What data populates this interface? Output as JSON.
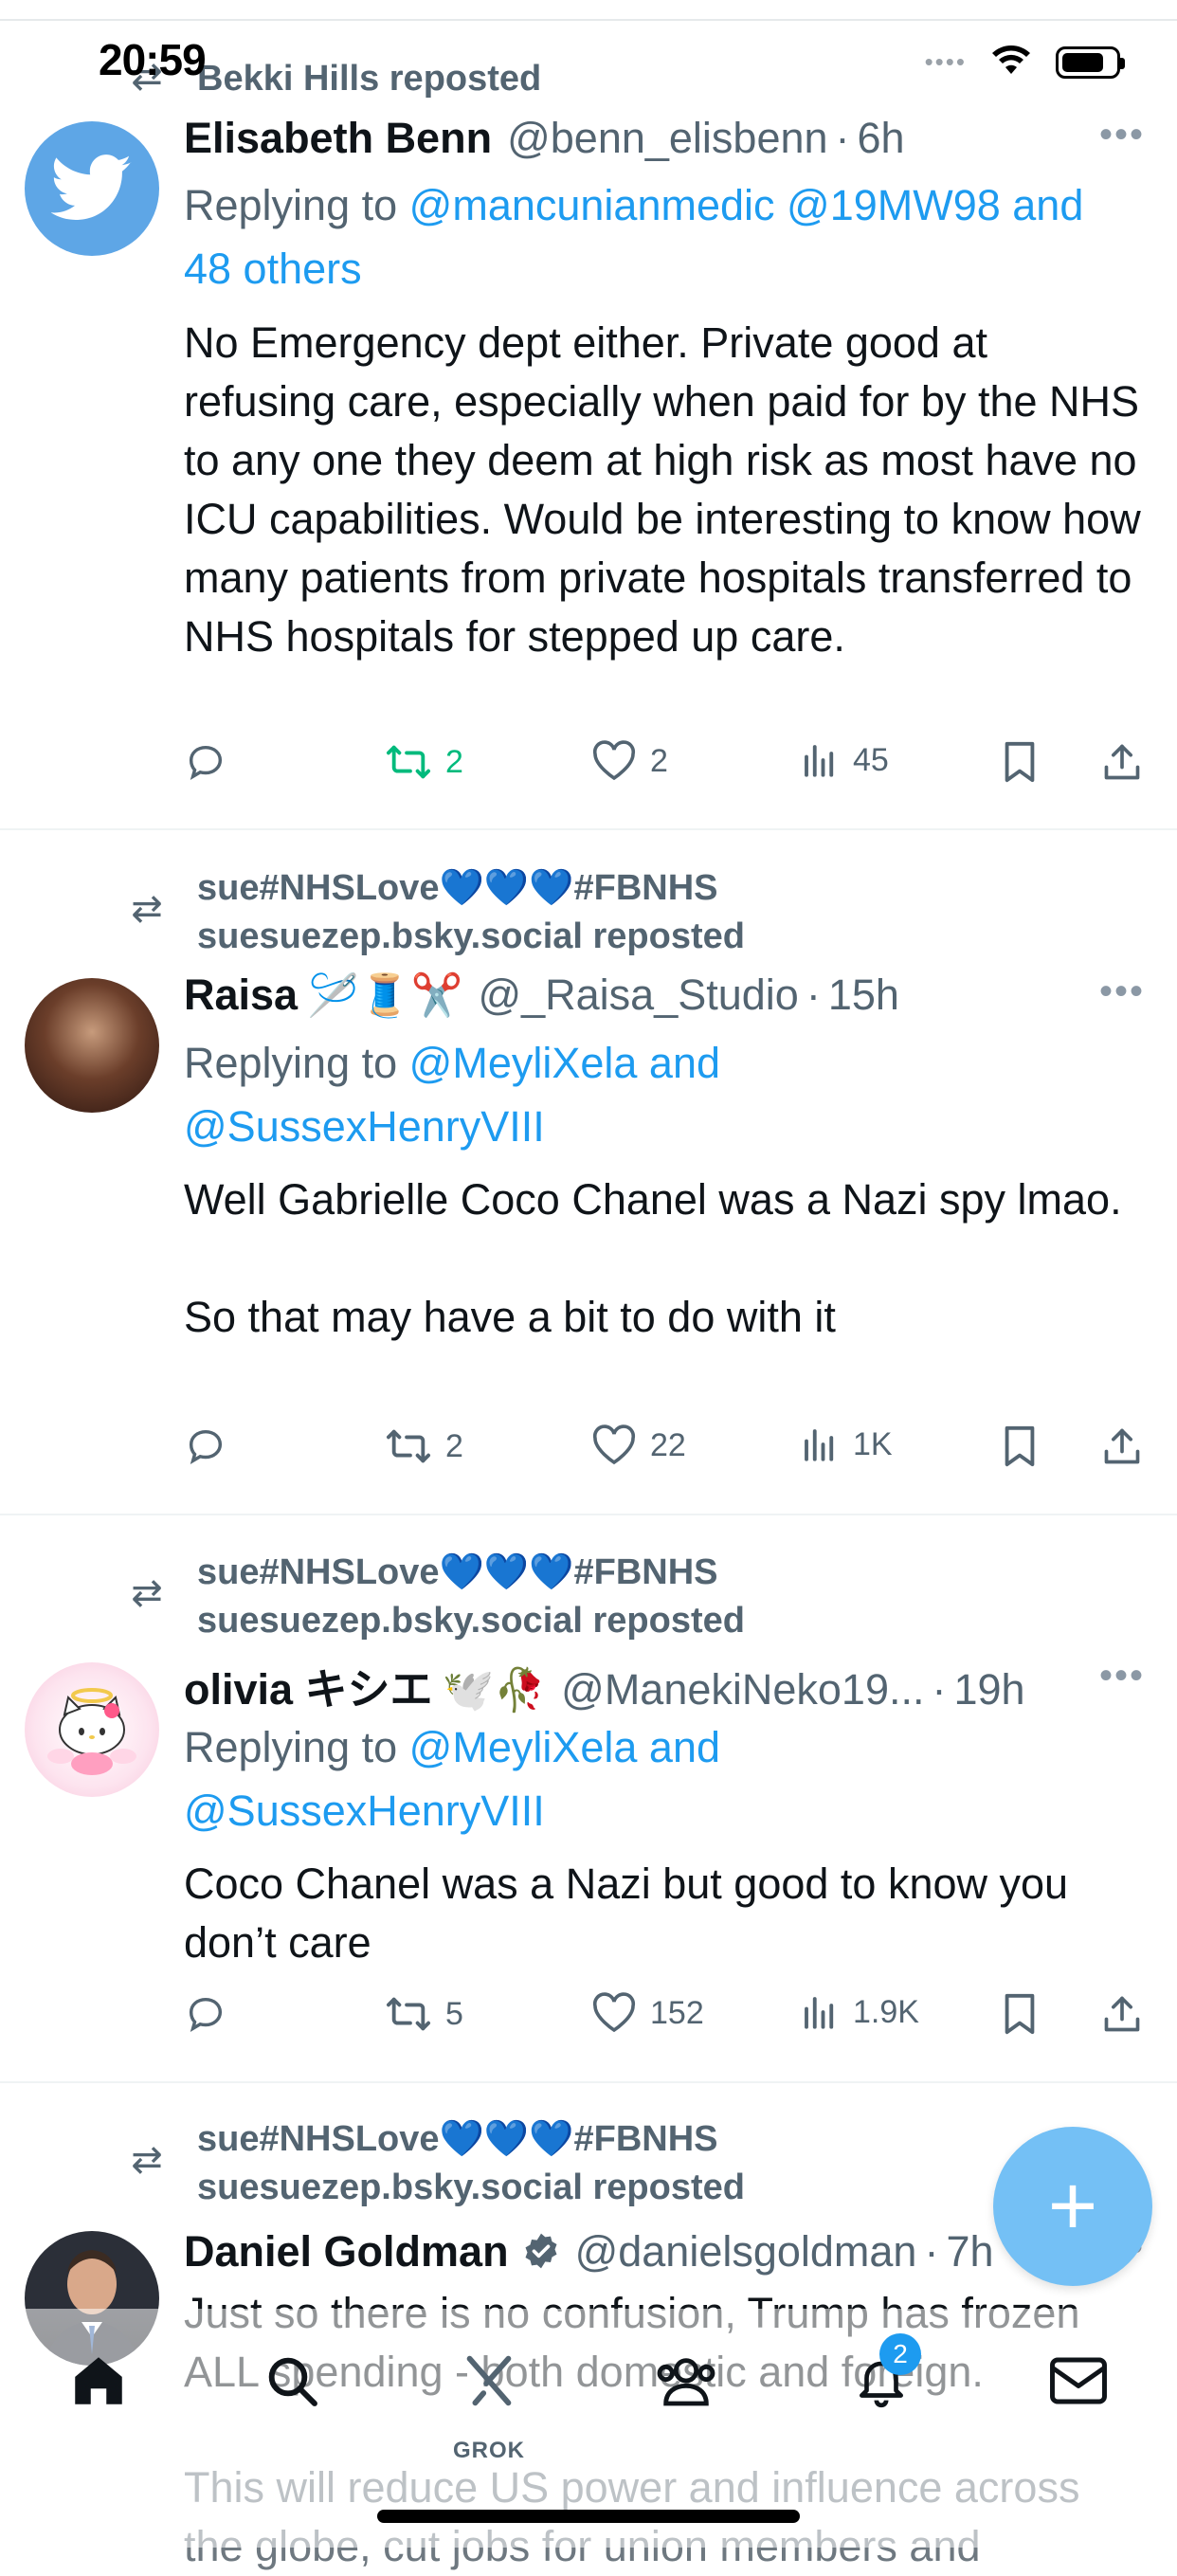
{
  "status_bar": {
    "time": "20:59",
    "signal": "••••",
    "wifi": "wifi-icon",
    "battery_level": 0.8
  },
  "posts": [
    {
      "repost_by": "Bekki Hills reposted",
      "name": "Elisabeth Benn",
      "name_emoji": "",
      "handle": "@benn_elisbenn",
      "time": "6h",
      "reply_prefix": "Replying to",
      "reply_mentions": "@mancunianmedic @19MW98 and 48 others",
      "text": "No Emergency dept either. Private good at refusing care, especially when paid for by the NHS to any one they deem at high risk as most have no ICU capabilities. Would be interesting to know how many patients from private hospitals transferred to NHS hospitals for stepped up care.",
      "retweets": "2",
      "likes": "2",
      "views": "45",
      "retweeted": true
    },
    {
      "repost_by": "sue#NHSLove💙💙💙#FBNHS\nsuesuezep.bsky.social reposted",
      "name": "Raisa",
      "name_emoji": "🪡🧵✂️",
      "handle": "@_Raisa_Studio",
      "time": "15h",
      "reply_prefix": "Replying to",
      "reply_mentions": "@MeyliXela and\n@SussexHenryVIII",
      "text": "Well Gabrielle Coco Chanel was a Nazi spy lmao.\n\nSo that may have a bit to do with it",
      "retweets": "2",
      "likes": "22",
      "views": "1K",
      "retweeted": false
    },
    {
      "repost_by": "sue#NHSLove💙💙💙#FBNHS\nsuesuezep.bsky.social reposted",
      "name": "olivia キシエ",
      "name_emoji": "🕊️🥀",
      "handle": "@ManekiNeko19...",
      "time": "19h",
      "reply_prefix": "Replying to",
      "reply_mentions": "@MeyliXela and\n@SussexHenryVIII",
      "text": "Coco Chanel was a Nazi but good to know you don’t care",
      "retweets": "5",
      "likes": "152",
      "views": "1.9K",
      "retweeted": false
    },
    {
      "repost_by": "sue#NHSLove💙💙💙#FBNHS\nsuesuezep.bsky.social reposted",
      "name": "Daniel Goldman",
      "name_emoji": "",
      "handle": "@danielsgoldman",
      "time": "7h",
      "text": "Just so there is no confusion, Trump has frozen ALL spending - both domestic and foreign.",
      "text2": "This will reduce US power and influence across the globe, cut jobs for union members and"
    }
  ],
  "tabbar": {
    "grok_label": "GROK",
    "notifications_count": "2"
  },
  "fab": "+",
  "colors": {
    "accent": "#1d9bf0",
    "retweet_green": "#00ba7c",
    "muted": "#536471"
  }
}
